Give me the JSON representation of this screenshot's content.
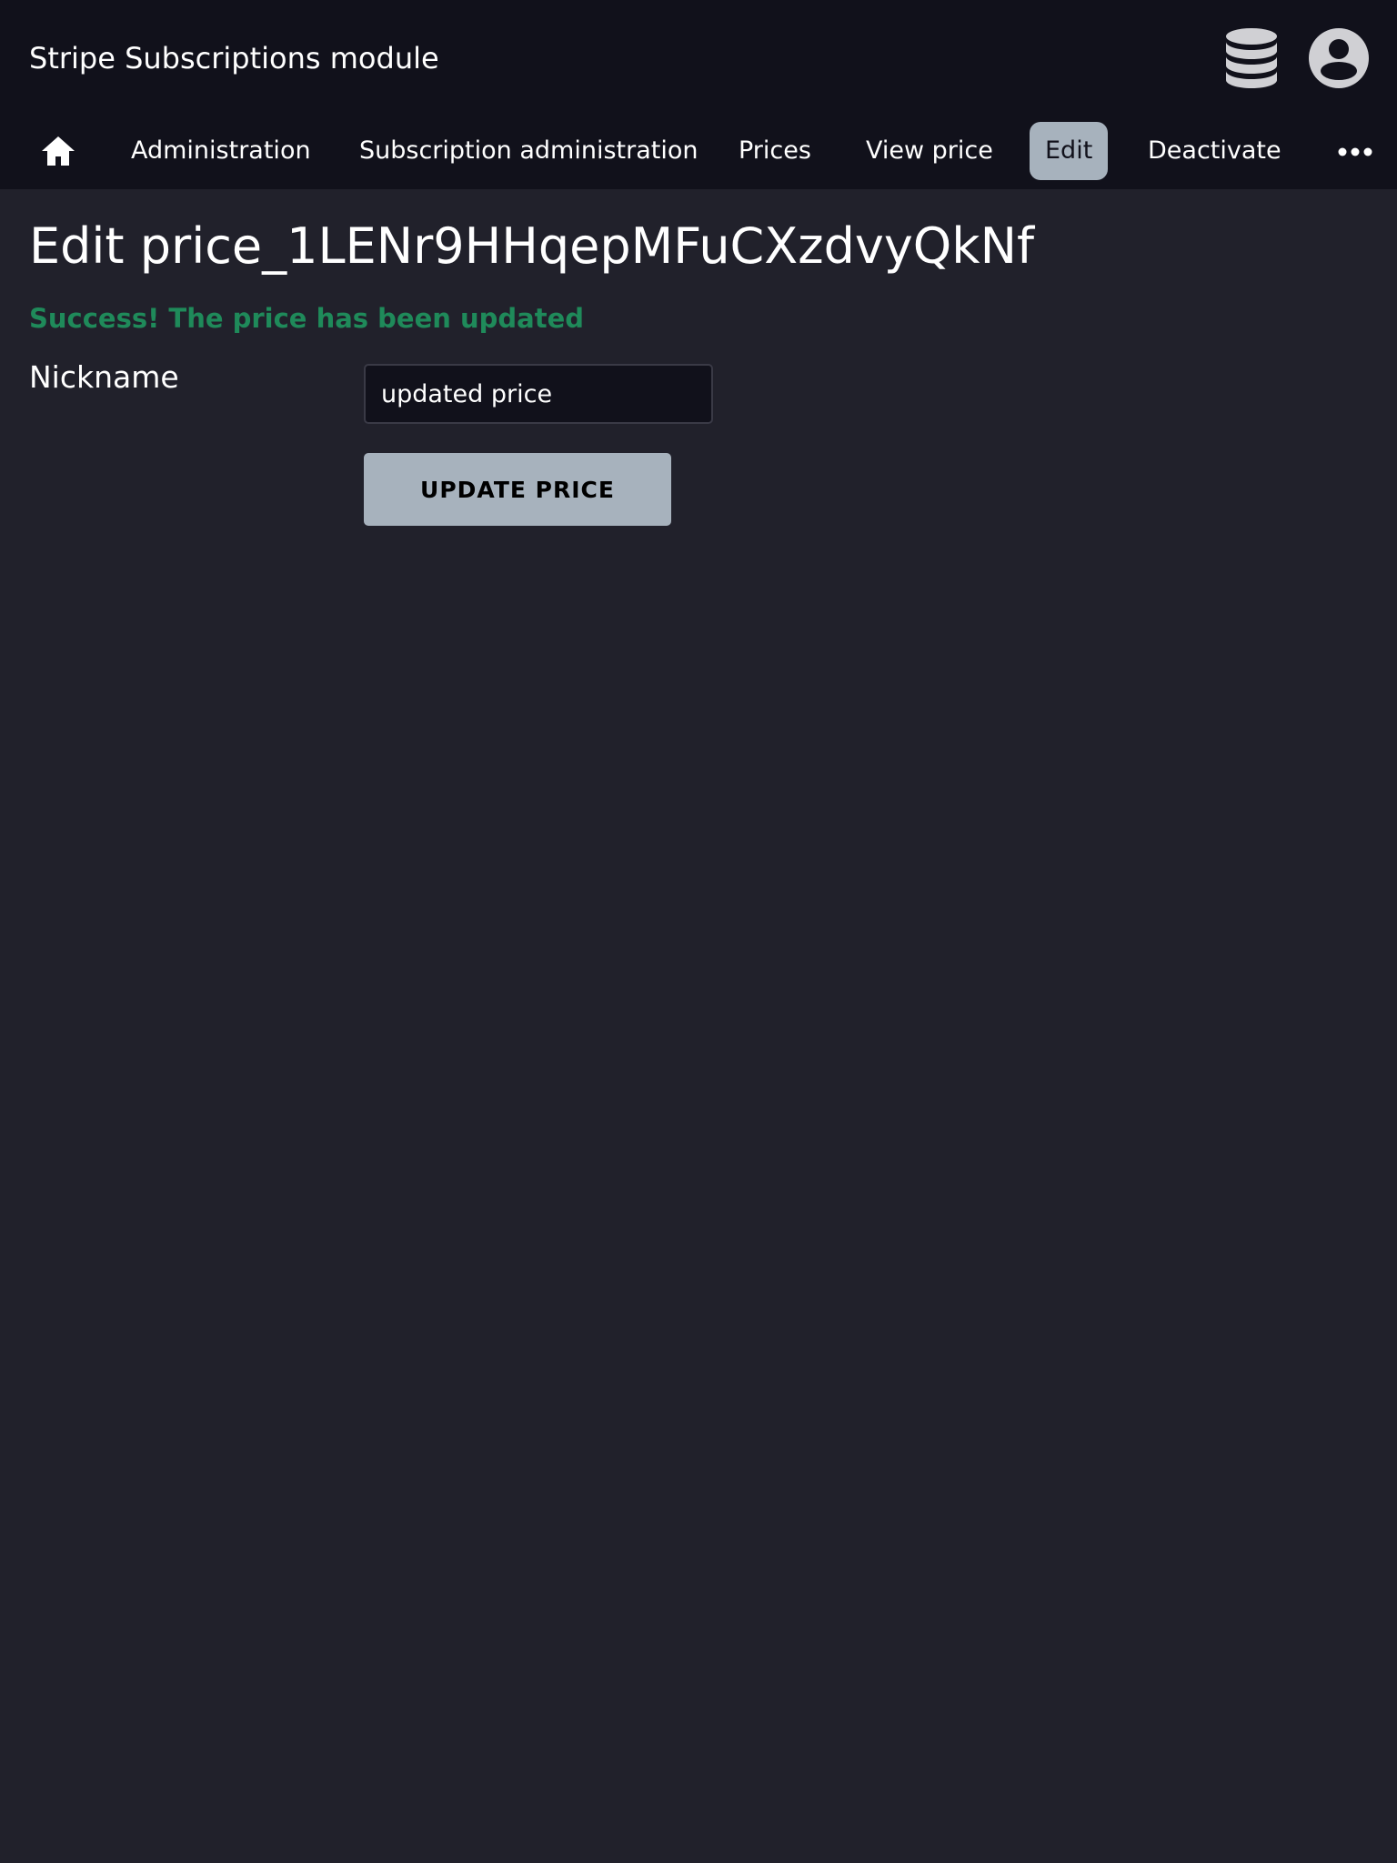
{
  "header": {
    "title": "Stripe Subscriptions module",
    "database_icon": "database-icon",
    "user_icon": "user-circle-icon"
  },
  "nav": {
    "home_icon": "home-icon",
    "items": [
      {
        "label": "Administration"
      },
      {
        "label": "Subscription administration"
      },
      {
        "label": "Prices"
      },
      {
        "label": "View price"
      },
      {
        "label": "Edit",
        "active": true
      },
      {
        "label": "Deactivate"
      }
    ],
    "more_icon": "more-horizontal-icon"
  },
  "main": {
    "title": "Edit price_1LENr9HHqepMFuCXzdvyQkNf",
    "success_message": "Success! The price has been updated",
    "form": {
      "nickname_label": "Nickname",
      "nickname_value": "updated price",
      "submit_label": "UPDATE PRICE"
    }
  },
  "colors": {
    "background": "#21212b",
    "bar_background": "#11111b",
    "accent": "#a7b2bd",
    "success": "#1f8a5a",
    "icon": "#d0d0d4"
  }
}
